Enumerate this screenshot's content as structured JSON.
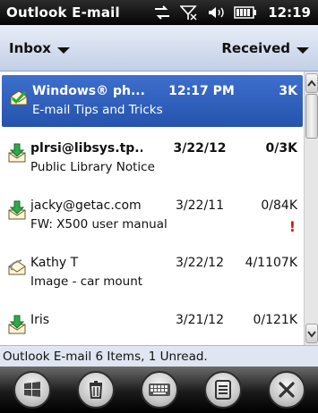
{
  "titlebar": {
    "app_title": "Outlook E-mail",
    "time": "12:19",
    "status_icons": [
      "sync-icon",
      "signal-off-icon",
      "volume-icon",
      "battery-icon"
    ]
  },
  "header": {
    "folder": "Inbox",
    "sort": "Received"
  },
  "messages": [
    {
      "sender": "Windows® ph...",
      "time": "12:17 PM",
      "size": "3K",
      "subject": "E-mail Tips and Tricks",
      "icon": "read-envelope-icon",
      "selected": true,
      "unread": true
    },
    {
      "sender": "plrsi@libsys.tp...",
      "time": "3/22/12",
      "size": "0/3K",
      "subject": "Public Library Notice",
      "icon": "download-envelope-icon",
      "unread": true
    },
    {
      "sender": "jacky@getac.com",
      "time": "3/22/11",
      "size": "0/84K",
      "subject": "FW: X500 user manual",
      "icon": "download-envelope-icon",
      "flag": "!"
    },
    {
      "sender": "Kathy T",
      "time": "3/22/12",
      "size": "4/1107K",
      "subject": "Image - car mount",
      "icon": "attachment-envelope-icon"
    },
    {
      "sender": "Iris",
      "time": "3/21/12",
      "size": "0/121K",
      "subject": "",
      "icon": "download-envelope-icon"
    }
  ],
  "status": "Outlook E-mail  6 Items, 1 Unread.",
  "toolbar": {
    "buttons": [
      "windows-start-icon",
      "delete-icon",
      "keyboard-icon",
      "menu-icon",
      "close-icon"
    ]
  },
  "colors": {
    "selection": "#2f60c0",
    "flag": "#d11a1a",
    "header_band": "#c8d4ea"
  }
}
